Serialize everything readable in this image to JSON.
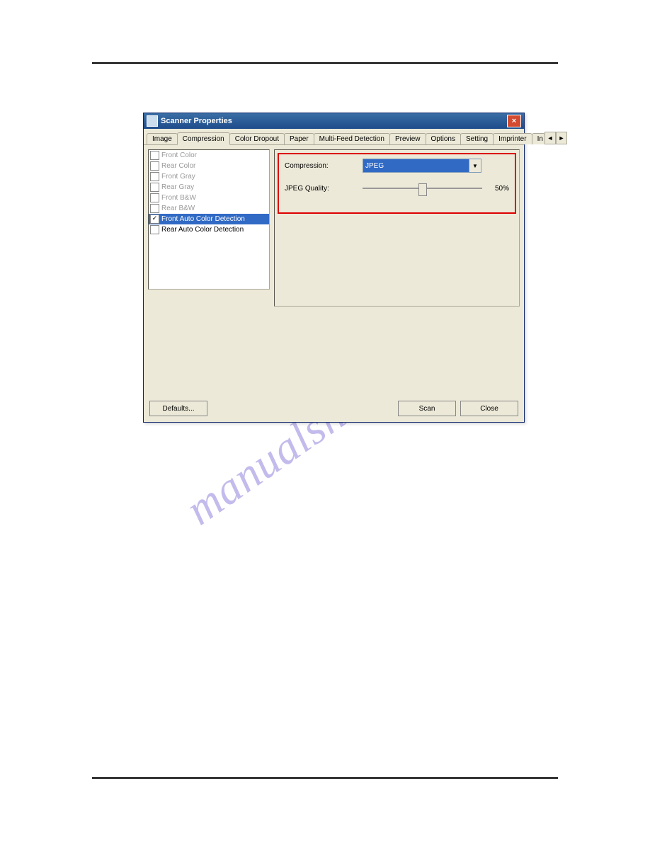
{
  "watermark_text": "manualshive.com",
  "window": {
    "title": "Scanner Properties"
  },
  "tabs": [
    {
      "label": "Image"
    },
    {
      "label": "Compression",
      "active": true
    },
    {
      "label": "Color Dropout"
    },
    {
      "label": "Paper"
    },
    {
      "label": "Multi-Feed Detection"
    },
    {
      "label": "Preview"
    },
    {
      "label": "Options"
    },
    {
      "label": "Setting"
    },
    {
      "label": "Imprinter"
    }
  ],
  "tab_truncated": "In",
  "sidelist": [
    {
      "label": "Front Color",
      "checked": false,
      "enabled": false
    },
    {
      "label": "Rear Color",
      "checked": false,
      "enabled": false
    },
    {
      "label": "Front Gray",
      "checked": false,
      "enabled": false
    },
    {
      "label": "Rear Gray",
      "checked": false,
      "enabled": false
    },
    {
      "label": "Front B&W",
      "checked": false,
      "enabled": false
    },
    {
      "label": "Rear B&W",
      "checked": false,
      "enabled": false
    },
    {
      "label": "Front Auto Color Detection",
      "checked": true,
      "enabled": true,
      "selected": true
    },
    {
      "label": "Rear Auto Color Detection",
      "checked": false,
      "enabled": true
    }
  ],
  "panel": {
    "compression_label": "Compression:",
    "compression_value": "JPEG",
    "jpeg_quality_label": "JPEG Quality:",
    "jpeg_quality_value": "50%"
  },
  "buttons": {
    "defaults": "Defaults...",
    "scan": "Scan",
    "close": "Close"
  }
}
